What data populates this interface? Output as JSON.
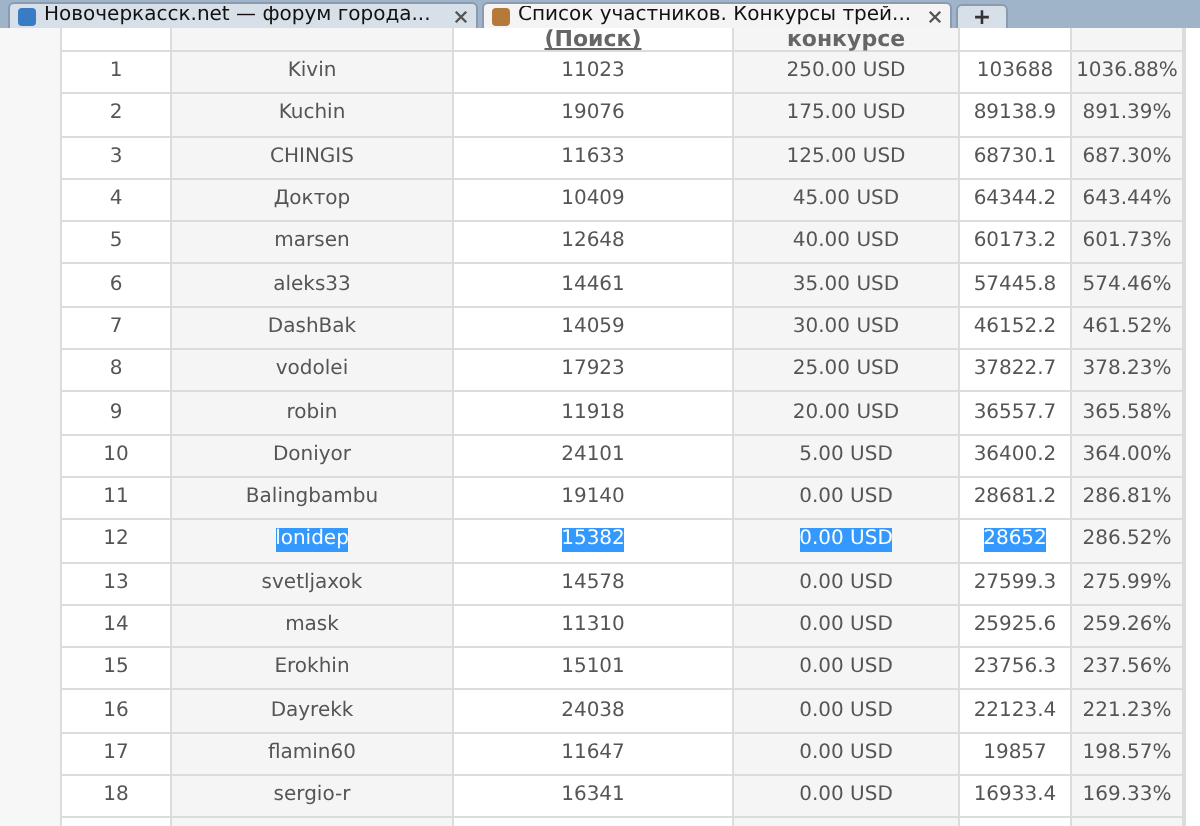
{
  "tabs": [
    {
      "title": "Новочеркасск.net — форум городa...",
      "selected": false
    },
    {
      "title": "Список участников. Конкурсы трей...",
      "selected": true
    }
  ],
  "new_tab": "+",
  "table": {
    "header": {
      "column_3": "(Поиск)",
      "column_4": "конкурсе"
    },
    "rows": [
      {
        "cells": [
          "1",
          "Kivin",
          "11023",
          "250.00 USD",
          "103688",
          "1036.88%"
        ],
        "selected": false
      },
      {
        "cells": [
          "2",
          "Kuchin",
          "19076",
          "175.00 USD",
          "89138.9",
          "891.39%"
        ],
        "selected": false
      },
      {
        "cells": [
          "3",
          "CHINGIS",
          "11633",
          "125.00 USD",
          "68730.1",
          "687.30%"
        ],
        "selected": false
      },
      {
        "cells": [
          "4",
          "Доктор",
          "10409",
          "45.00 USD",
          "64344.2",
          "643.44%"
        ],
        "selected": false
      },
      {
        "cells": [
          "5",
          "marsen",
          "12648",
          "40.00 USD",
          "60173.2",
          "601.73%"
        ],
        "selected": false
      },
      {
        "cells": [
          "6",
          "aleks33",
          "14461",
          "35.00 USD",
          "57445.8",
          "574.46%"
        ],
        "selected": false
      },
      {
        "cells": [
          "7",
          "DashBak",
          "14059",
          "30.00 USD",
          "46152.2",
          "461.52%"
        ],
        "selected": false
      },
      {
        "cells": [
          "8",
          "vodolei",
          "17923",
          "25.00 USD",
          "37822.7",
          "378.23%"
        ],
        "selected": false
      },
      {
        "cells": [
          "9",
          "robin",
          "11918",
          "20.00 USD",
          "36557.7",
          "365.58%"
        ],
        "selected": false
      },
      {
        "cells": [
          "10",
          "Doniyor",
          "24101",
          "5.00 USD",
          "36400.2",
          "364.00%"
        ],
        "selected": false
      },
      {
        "cells": [
          "11",
          "Balingbambu",
          "19140",
          "0.00 USD",
          "28681.2",
          "286.81%"
        ],
        "selected": false
      },
      {
        "cells": [
          "12",
          "lonidep",
          "15382",
          "0.00 USD",
          "28652",
          "286.52%"
        ],
        "selected": true
      },
      {
        "cells": [
          "13",
          "svetljaxok",
          "14578",
          "0.00 USD",
          "27599.3",
          "275.99%"
        ],
        "selected": false
      },
      {
        "cells": [
          "14",
          "mask",
          "11310",
          "0.00 USD",
          "25925.6",
          "259.26%"
        ],
        "selected": false
      },
      {
        "cells": [
          "15",
          "Erokhin",
          "15101",
          "0.00 USD",
          "23756.3",
          "237.56%"
        ],
        "selected": false
      },
      {
        "cells": [
          "16",
          "Dayrekk",
          "24038",
          "0.00 USD",
          "22123.4",
          "221.23%"
        ],
        "selected": false
      },
      {
        "cells": [
          "17",
          "flamin60",
          "11647",
          "0.00 USD",
          "19857",
          "198.57%"
        ],
        "selected": false
      },
      {
        "cells": [
          "18",
          "sergio-r",
          "16341",
          "0.00 USD",
          "16933.4",
          "169.33%"
        ],
        "selected": false
      }
    ]
  }
}
